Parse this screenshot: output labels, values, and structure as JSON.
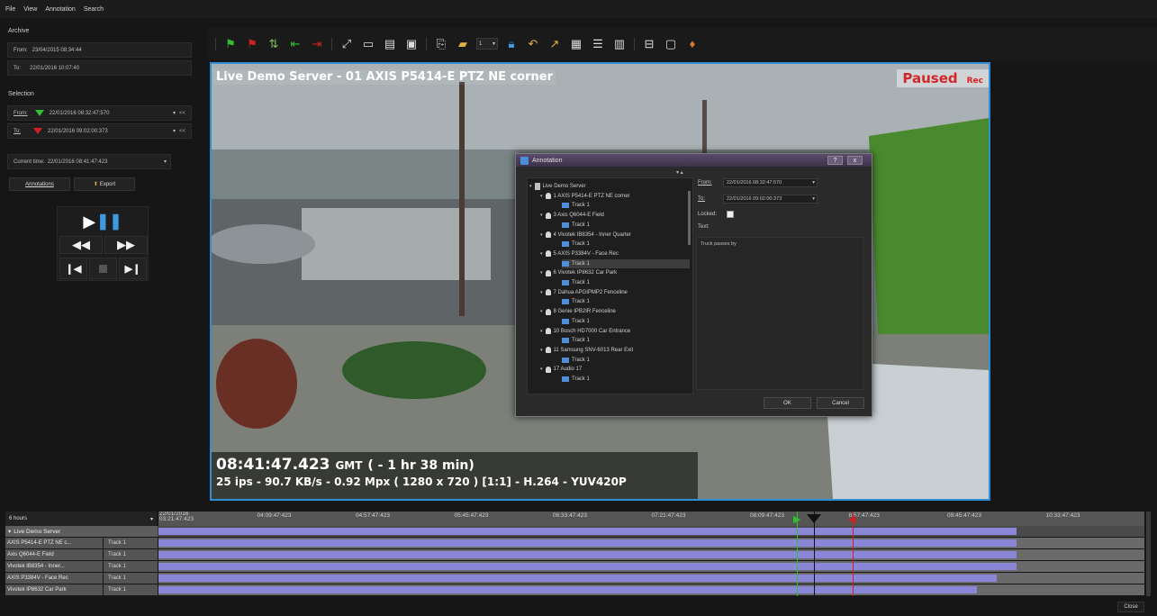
{
  "menu": {
    "items": [
      "File",
      "View",
      "Annotation",
      "Search"
    ]
  },
  "left": {
    "archive_label": "Archive",
    "archive_from_label": "From:",
    "archive_from_value": "23/04/2015 08:34:44",
    "archive_to_label": "To:",
    "archive_to_value": "22/01/2016 10:07:40",
    "selection_label": "Selection",
    "sel_from_label": "From:",
    "sel_from_value": "22/01/2016 08:32:47:570",
    "sel_to_label": "To:",
    "sel_to_value": "22/01/2016 09:02:00:373",
    "rewind_label": "<<",
    "current_time_label": "Current time:",
    "current_time_value": "22/01/2016 08:41:47:423",
    "annotations_button": "Annotations",
    "export_button": "Export"
  },
  "video": {
    "title": "Live Demo Server - 01 AXIS P5414-E PTZ NE corner",
    "paused_label": "Paused",
    "rec_label": "Rec",
    "time_main": "08:41:47.423",
    "time_zone": "GMT",
    "time_offset": "( - 1 hr 38 min)",
    "stats": "25 ips  -  90.7 KB/s  -  0.92 Mpx  ( 1280 x 720 ) [1:1] -  H.264  -  YUV420P"
  },
  "toolbar": {
    "zoom_value": "1"
  },
  "dialog": {
    "title": "Annotation",
    "help_button": "?",
    "close_button": "x",
    "tree": [
      {
        "label": "Live Demo Server",
        "kind": "server",
        "level": 0
      },
      {
        "label": "1 AXIS P5414-E PTZ NE corner",
        "kind": "camera",
        "level": 1
      },
      {
        "label": "Track 1",
        "kind": "track",
        "level": 2
      },
      {
        "label": "3 Axis Q6044-E Field",
        "kind": "camera",
        "level": 1
      },
      {
        "label": "Track 1",
        "kind": "track",
        "level": 2
      },
      {
        "label": "4 Vivotek IB8354 - Inner Quarter",
        "kind": "camera",
        "level": 1
      },
      {
        "label": "Track 1",
        "kind": "track",
        "level": 2
      },
      {
        "label": "5 AXIS P3384V - Face Rec",
        "kind": "camera",
        "level": 1
      },
      {
        "label": "Track 1",
        "kind": "track",
        "level": 2,
        "selected": true
      },
      {
        "label": "6 Vivotek IP8632 Car Park",
        "kind": "camera",
        "level": 1
      },
      {
        "label": "Track 1",
        "kind": "track",
        "level": 2
      },
      {
        "label": "7 Dahua APGIPMP2 Fenceline",
        "kind": "camera",
        "level": 1
      },
      {
        "label": "Track 1",
        "kind": "track",
        "level": 2
      },
      {
        "label": "8 Genie IPB2IR Fenceline",
        "kind": "camera",
        "level": 1
      },
      {
        "label": "Track 1",
        "kind": "track",
        "level": 2
      },
      {
        "label": "10 Bosch HD7000 Car Entrance",
        "kind": "camera",
        "level": 1
      },
      {
        "label": "Track 1",
        "kind": "track",
        "level": 2
      },
      {
        "label": "11 Samsung SNV-6013 Rear Exit",
        "kind": "camera",
        "level": 1
      },
      {
        "label": "Track 1",
        "kind": "track",
        "level": 2
      },
      {
        "label": "17 Audio 17",
        "kind": "audio",
        "level": 1
      },
      {
        "label": "Track 1",
        "kind": "track",
        "level": 2
      }
    ],
    "from_label": "From:",
    "from_value": "22/01/2016 08:32:47:570",
    "to_label": "To:",
    "to_value": "22/01/2016 09:02:00:373",
    "locked_label": "Locked:",
    "text_label": "Text:",
    "text_value": "Truck passes by",
    "ok_button": "OK",
    "cancel_button": "Cancel"
  },
  "timeline": {
    "range_label": "6 hours",
    "ticks": [
      "22/01/2016 03:21:47:423",
      "04:09:47:423",
      "04:57:47:423",
      "05:45:47:423",
      "06:33:47:423",
      "07:21:47:423",
      "08:09:47:423",
      "8:57:47:423",
      "09:45:47:423",
      "10:33:47:423"
    ],
    "server": "Live Demo Server",
    "rows": [
      {
        "name": "AXIS P5414-E PTZ NE c...",
        "track": "Track 1",
        "end": 0.87
      },
      {
        "name": "Axis Q6044-E Field",
        "track": "Track 1",
        "end": 0.87
      },
      {
        "name": "Vivotek IB8354 - Inner...",
        "track": "Track 1",
        "end": 0.87
      },
      {
        "name": "AXIS P3384V - Face Rec",
        "track": "Track 1",
        "end": 0.85
      },
      {
        "name": "Vivotek IP8632 Car Park",
        "track": "Track 1",
        "end": 0.83
      }
    ],
    "close_button": "Close"
  },
  "colors": {
    "accent": "#2f8ed4",
    "track_fill": "#8a87d9",
    "selection_start": "#30c030",
    "selection_end": "#d02020"
  }
}
